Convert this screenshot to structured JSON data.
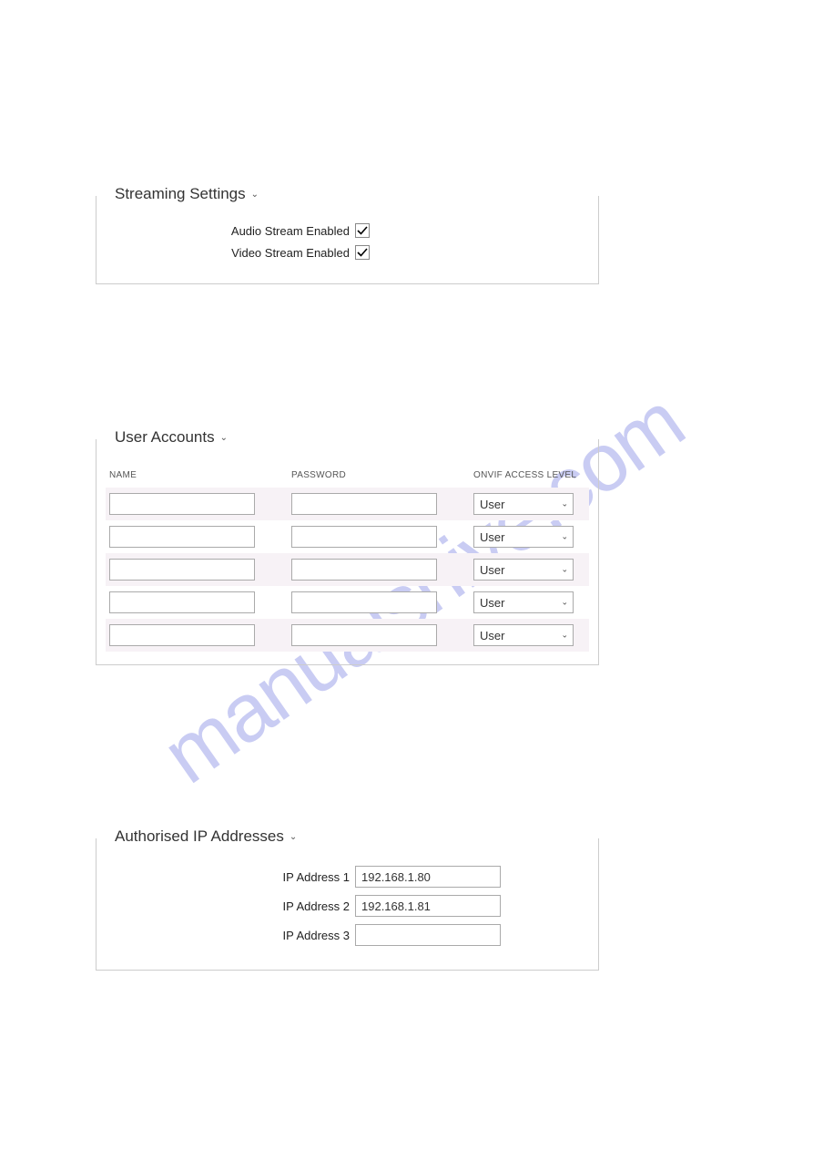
{
  "watermark": "manualshive.com",
  "streaming": {
    "title": "Streaming Settings",
    "audio_label": "Audio Stream Enabled",
    "audio_checked": true,
    "video_label": "Video Stream Enabled",
    "video_checked": true
  },
  "users": {
    "title": "User Accounts",
    "headers": {
      "name": "NAME",
      "password": "PASSWORD",
      "level": "ONVIF ACCESS LEVEL"
    },
    "rows": [
      {
        "name": "",
        "password": "",
        "level": "User"
      },
      {
        "name": "",
        "password": "",
        "level": "User"
      },
      {
        "name": "",
        "password": "",
        "level": "User"
      },
      {
        "name": "",
        "password": "",
        "level": "User"
      },
      {
        "name": "",
        "password": "",
        "level": "User"
      }
    ]
  },
  "ip": {
    "title": "Authorised IP Addresses",
    "rows": [
      {
        "label": "IP Address 1",
        "value": "192.168.1.80"
      },
      {
        "label": "IP Address 2",
        "value": "192.168.1.81"
      },
      {
        "label": "IP Address 3",
        "value": ""
      }
    ]
  }
}
